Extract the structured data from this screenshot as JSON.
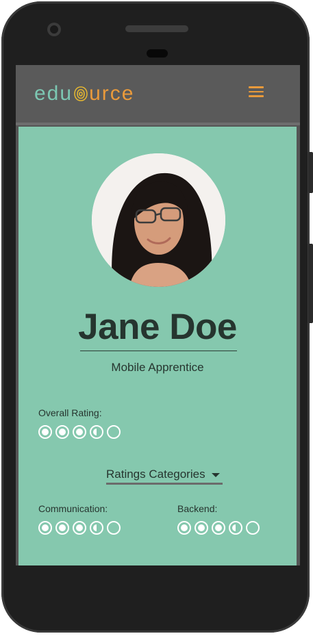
{
  "app": {
    "logo_left": "edu",
    "logo_right": "urce"
  },
  "profile": {
    "name": "Jane Doe",
    "role": "Mobile Apprentice"
  },
  "overall": {
    "label": "Overall Rating:",
    "rating": 3.5,
    "max": 5
  },
  "categories_select": {
    "label": "Ratings Categories"
  },
  "categories": [
    {
      "label": "Communication:",
      "rating": 3.5,
      "max": 5
    },
    {
      "label": "Backend:",
      "rating": 3.5,
      "max": 5
    }
  ],
  "colors": {
    "content_bg": "#85c8ae",
    "accent": "#e99a3b",
    "logo_teal": "#7cc7b2",
    "text": "#26352f"
  },
  "icons": [
    "menu-icon",
    "fingerprint-icon",
    "caret-down-icon",
    "rating-dot-icon"
  ]
}
